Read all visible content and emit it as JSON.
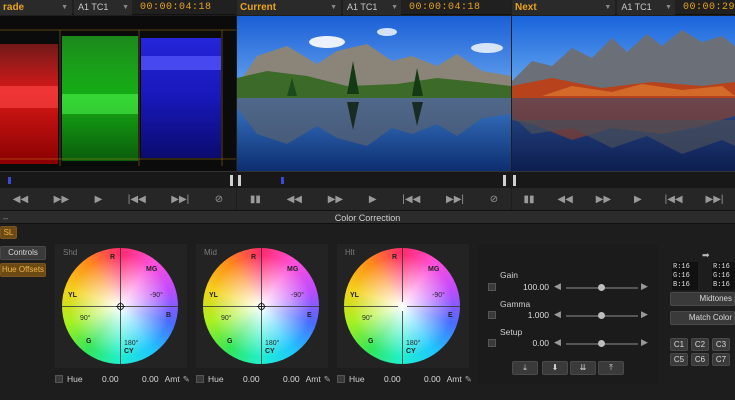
{
  "headers": {
    "grade": {
      "title": "rade",
      "tc_label": "A1 TC1",
      "time": "00:00:04:18"
    },
    "current": {
      "title": "Current",
      "tc_label": "A1 TC1",
      "time": "00:00:04:18"
    },
    "next": {
      "title": "Next",
      "tc_label": "A1 TC1",
      "time": "00:00:29"
    }
  },
  "panel_title": "Color Correction",
  "left_buttons": {
    "hsl": "SL",
    "controls": "Controls",
    "hue_offsets": "Hue Offsets"
  },
  "wheels": [
    {
      "label": "Shd",
      "hue": "0.00",
      "value": "0.00",
      "amt": "Amt",
      "hue_label": "Hue",
      "mg": "MG",
      "r": "R",
      "yl": "YL",
      "b": "B",
      "g": "G",
      "cy": "CY",
      "deg_top": "-90°",
      "deg_mid": "90°",
      "deg_bot": "180°",
      "e": "E"
    },
    {
      "label": "Mid",
      "hue": "0.00",
      "value": "0.00",
      "amt": "Amt",
      "hue_label": "Hue",
      "mg": "MG",
      "r": "R",
      "yl": "YL",
      "b": "B",
      "g": "G",
      "cy": "CY",
      "deg_top": "-90°",
      "deg_mid": "90°",
      "deg_bot": "180°",
      "e": "E"
    },
    {
      "label": "Hlt",
      "hue": "0.00",
      "value": "0.00",
      "amt": "Amt",
      "hue_label": "Hue",
      "mg": "MG",
      "r": "R",
      "yl": "YL",
      "b": "B",
      "g": "G",
      "cy": "CY",
      "deg_top": "-90°",
      "deg_mid": "90°",
      "deg_bot": "180°",
      "e": "E"
    }
  ],
  "sliders": {
    "gain": {
      "label": "Gain",
      "value": "100.00"
    },
    "gamma": {
      "label": "Gamma",
      "value": "1.000"
    },
    "setup": {
      "label": "Setup",
      "value": "0.00"
    }
  },
  "rgb_readout_left": {
    "r": "R:16",
    "g": "G:16",
    "b": "B:16"
  },
  "rgb_readout_right": {
    "r": "R:16",
    "g": "G:16",
    "b": "B:16"
  },
  "right_buttons": {
    "midtones": "Midtones",
    "match_color": "Match Color"
  },
  "cbuttons": [
    "C1",
    "C2",
    "C3",
    "C5",
    "C6",
    "C7"
  ],
  "colors": {
    "accent": "#e8a320",
    "bg": "#1e1e1e"
  }
}
